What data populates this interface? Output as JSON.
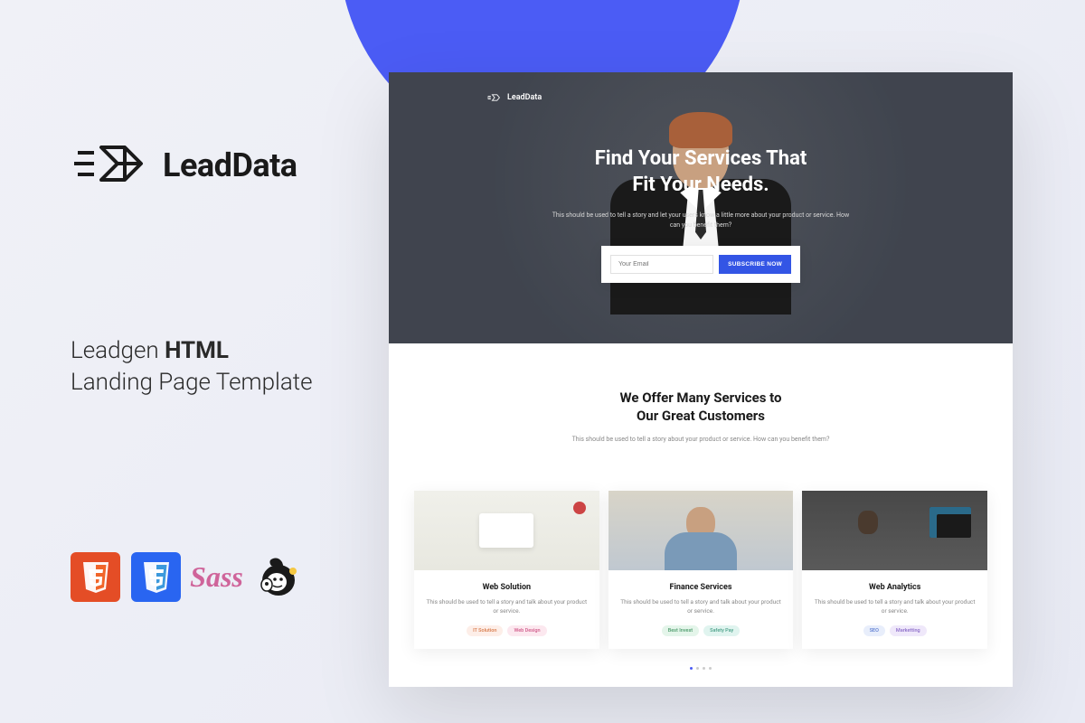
{
  "brand": {
    "name": "LeadData"
  },
  "tagline": {
    "line1_prefix": "Leadgen ",
    "line1_bold": "HTML",
    "line2": "Landing Page Template"
  },
  "tech": {
    "html5": "HTML5",
    "css3": "CSS3",
    "sass": "Sass",
    "mailchimp": "Mailchimp"
  },
  "preview": {
    "logo_text": "LeadData",
    "hero": {
      "title_line1": "Find Your Services That",
      "title_line2": "Fit Your Needs.",
      "subtitle": "This should be used to tell a story and let your users know a little more about your product or service. How can you benefit them?"
    },
    "signup": {
      "email_placeholder": "Your Email",
      "button": "SUBSCRIBE NOW"
    },
    "services": {
      "title_line1": "We Offer Many Services to",
      "title_line2": "Our Great Customers",
      "subtitle": "This should be used to tell a story about your product or service. How can you benefit them?"
    },
    "cards": [
      {
        "title": "Web Solution",
        "desc": "This should be used to tell a story and talk about your product or service.",
        "tags": [
          "IT Solution",
          "Web Design"
        ]
      },
      {
        "title": "Finance Services",
        "desc": "This should be used to tell a story and talk about your product or service.",
        "tags": [
          "Best Invest",
          "Safety Pay"
        ]
      },
      {
        "title": "Web Analytics",
        "desc": "This should be used to tell a story and talk about your product or service.",
        "tags": [
          "SEO",
          "Marketting"
        ]
      }
    ],
    "carousel": {
      "active": 0,
      "count": 4
    }
  },
  "colors": {
    "accent": "#4b5cf5",
    "cta": "#3355e5"
  }
}
